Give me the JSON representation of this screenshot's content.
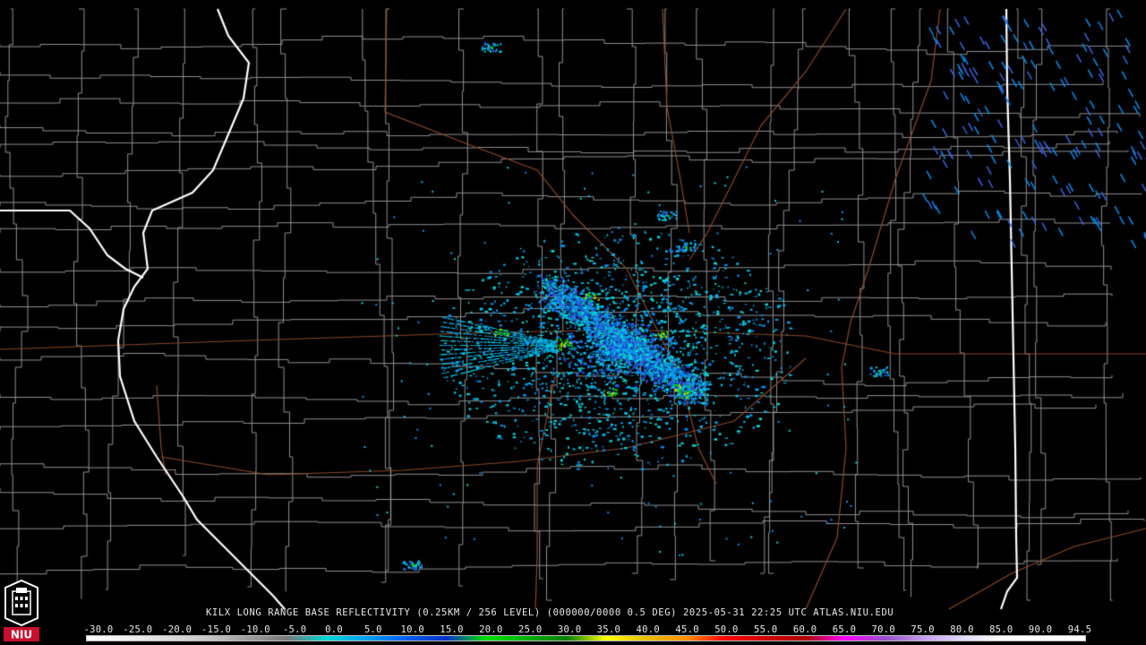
{
  "product": {
    "caption": "KILX LONG RANGE BASE REFLECTIVITY (0.25KM / 256 LEVEL) (000000/0000 0.5 DEG) 2025-05-31 22:25 UTC  ATLAS.NIU.EDU"
  },
  "scale": {
    "labels": [
      "-30.0",
      "-25.0",
      "-20.0",
      "-15.0",
      "-10.0",
      "-5.0",
      "0.0",
      "5.0",
      "10.0",
      "15.0",
      "20.0",
      "25.0",
      "30.0",
      "35.0",
      "40.0",
      "45.0",
      "50.0",
      "55.0",
      "60.0",
      "65.0",
      "70.0",
      "75.0",
      "80.0",
      "85.0",
      "90.0",
      "94.5"
    ],
    "colors": [
      "#ffffff",
      "#f0f0f0",
      "#dcdcdc",
      "#c8c8c8",
      "#a0a0a0",
      "#787878",
      "#00d8d8",
      "#00a0f0",
      "#0060f0",
      "#0030c8",
      "#00e000",
      "#00b400",
      "#008000",
      "#ffff00",
      "#e8c000",
      "#ff9000",
      "#ff0000",
      "#d00000",
      "#b00000",
      "#ff00ff",
      "#9850c8",
      "#c8a0f0",
      "#e0e0ff",
      "#ffffff",
      "#ffffff",
      "#ffffff"
    ]
  },
  "map": {
    "background_color": "#000000",
    "state_border_color": "#ffffff",
    "county_border_color": "#909090",
    "highway_color": "#8b4a2a",
    "radar_site": "KILX",
    "echo_palette": [
      "#00d8d8",
      "#00b8e8",
      "#0090f0",
      "#3a64e0",
      "#1a40c0",
      "#00d000",
      "#d8d800",
      "#a0e8ff"
    ]
  },
  "logo": {
    "text": "NIU"
  }
}
